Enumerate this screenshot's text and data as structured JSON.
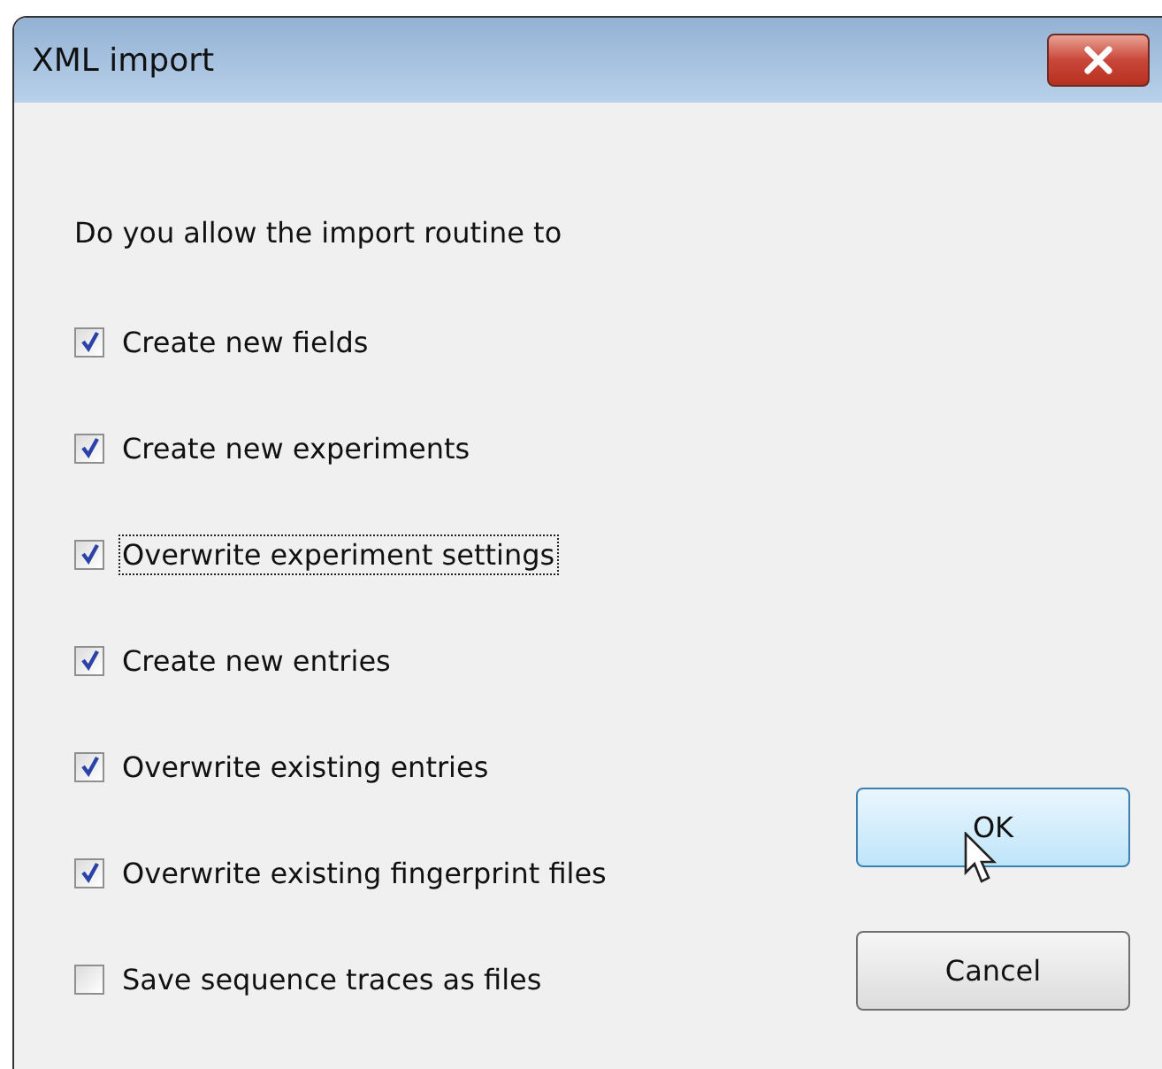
{
  "window": {
    "title": "XML import"
  },
  "prompt": "Do you allow the import routine to",
  "options": [
    {
      "label": "Create new fields",
      "checked": true,
      "focused": false
    },
    {
      "label": "Create new experiments",
      "checked": true,
      "focused": false
    },
    {
      "label": "Overwrite experiment settings",
      "checked": true,
      "focused": true
    },
    {
      "label": "Create new entries",
      "checked": true,
      "focused": false
    },
    {
      "label": "Overwrite existing entries",
      "checked": true,
      "focused": false
    },
    {
      "label": "Overwrite existing fingerprint files",
      "checked": true,
      "focused": false
    },
    {
      "label": "Save sequence traces as files",
      "checked": false,
      "focused": false
    }
  ],
  "buttons": [
    {
      "label": "OK",
      "hovered": true
    },
    {
      "label": "Cancel",
      "hovered": false
    }
  ]
}
